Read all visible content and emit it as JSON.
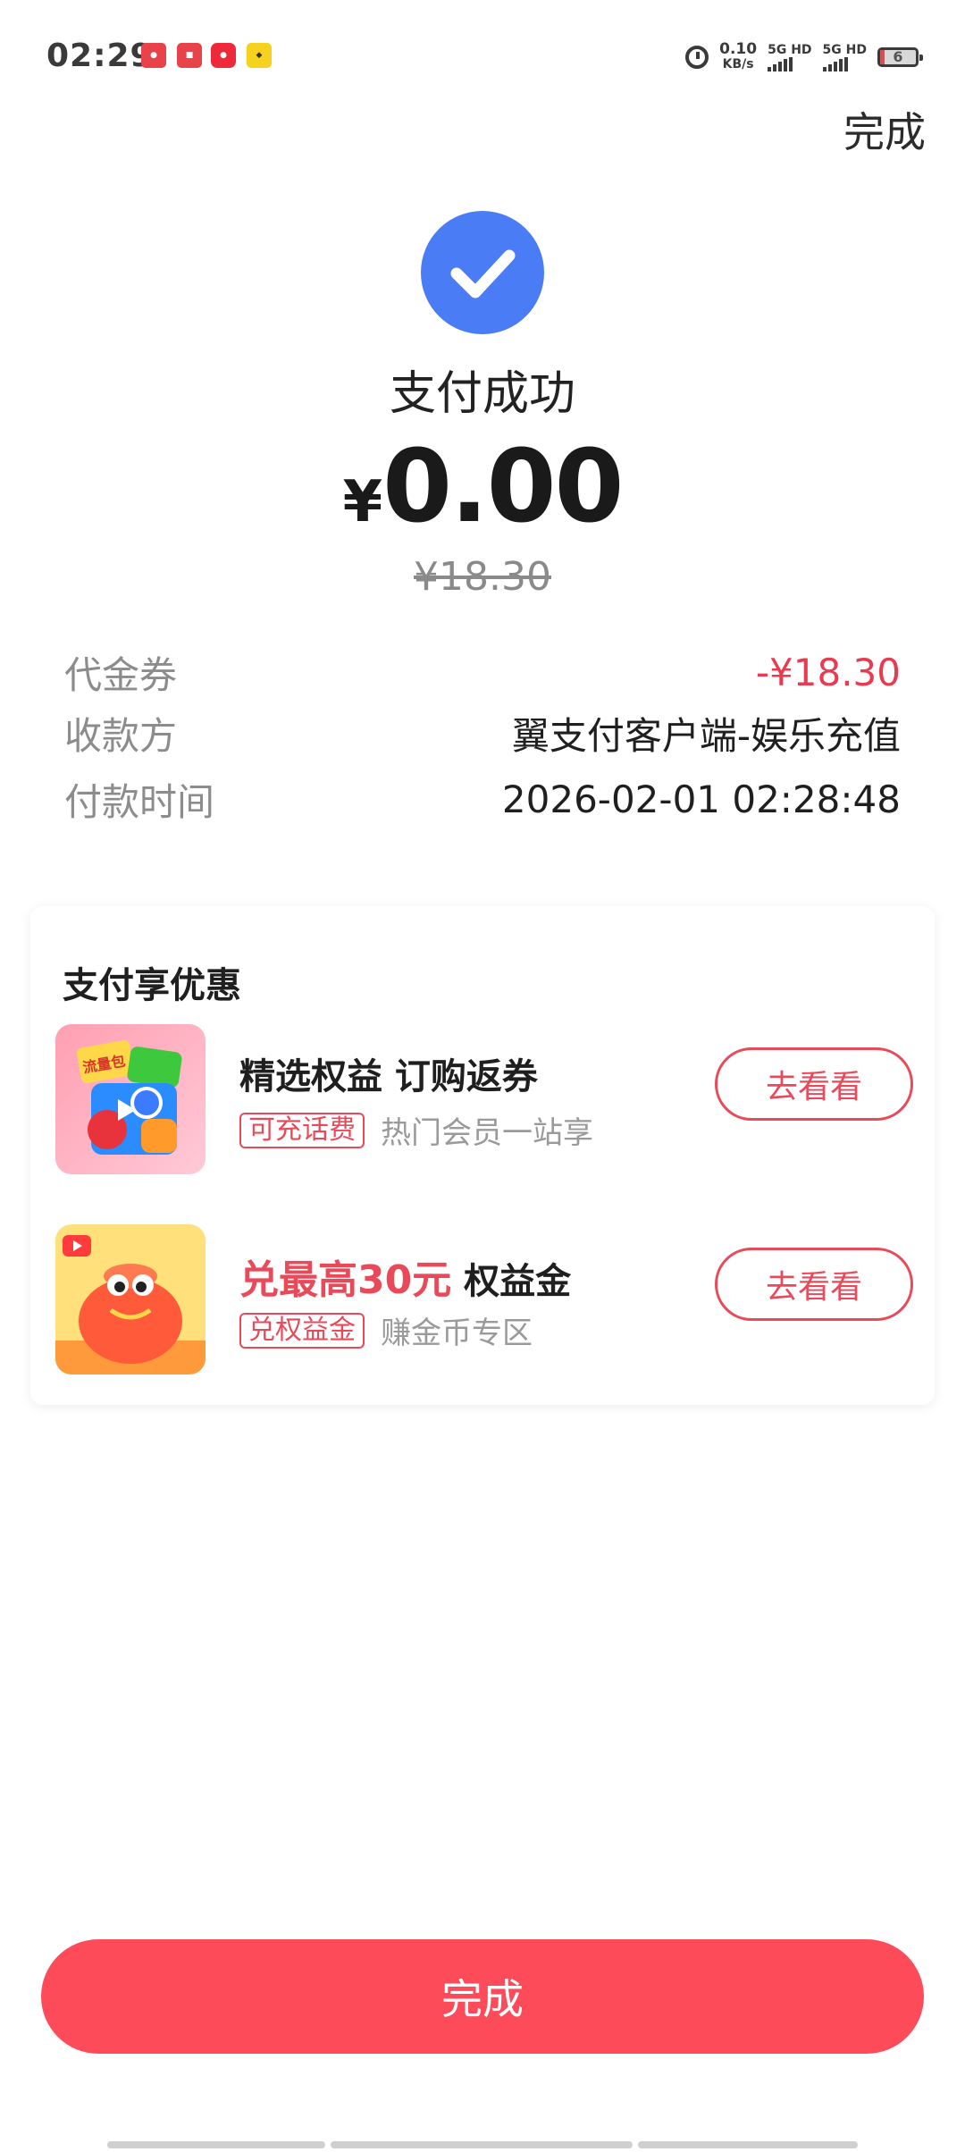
{
  "status_bar": {
    "time": "02:29",
    "net_speed_value": "0.10",
    "net_speed_unit": "KB/s",
    "sim1_label": "5G HD",
    "sim2_label": "5G HD",
    "battery": "6",
    "notification_icons": [
      "app-notification-icon",
      "app-notification-icon",
      "app-notification-icon",
      "app-notification-icon"
    ]
  },
  "header": {
    "done_label": "完成"
  },
  "result": {
    "title": "支付成功",
    "currency_symbol": "¥",
    "amount": "0.00",
    "original_price": "¥18.30"
  },
  "details": [
    {
      "label": "代金券",
      "value": "-¥18.30",
      "accent": "#e83a50"
    },
    {
      "label": "收款方",
      "value": "翼支付客户端-娱乐充值"
    },
    {
      "label": "付款时间",
      "value": "2026-02-01 02:28:48"
    }
  ],
  "promo": {
    "title": "支付享优惠",
    "items": [
      {
        "title": "精选权益 订购返券",
        "tag": "可充话费",
        "subtitle": "热门会员一站享",
        "button": "去看看",
        "thumb_text": "流量包"
      },
      {
        "title_highlight": "兑最高30元",
        "title_rest": " 权益金",
        "tag": "兑权益金",
        "subtitle": "赚金币专区",
        "button": "去看看"
      }
    ]
  },
  "footer": {
    "done_label": "完成"
  },
  "colors": {
    "accent_red": "#fd4b5a",
    "success_blue": "#4a7cf5",
    "tag_red": "#e84a5a"
  }
}
